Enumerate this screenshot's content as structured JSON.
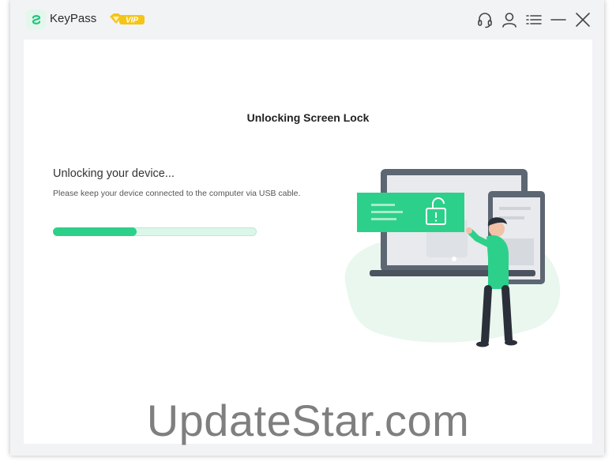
{
  "app": {
    "name": "KeyPass",
    "vip_badge": "VIP"
  },
  "titlebar": {
    "icons": [
      "support-icon",
      "account-icon",
      "menu-icon",
      "minimize-icon",
      "close-icon"
    ]
  },
  "main": {
    "title": "Unlocking Screen Lock",
    "status_heading": "Unlocking your device...",
    "status_subtext": "Please keep your device connected to the computer via USB cable.",
    "progress": 0.41
  },
  "watermark": "UpdateStar.com",
  "colors": {
    "accent": "#2dd08a",
    "accent_light": "#dcf7ea",
    "vip_gold": "#f5c516"
  }
}
